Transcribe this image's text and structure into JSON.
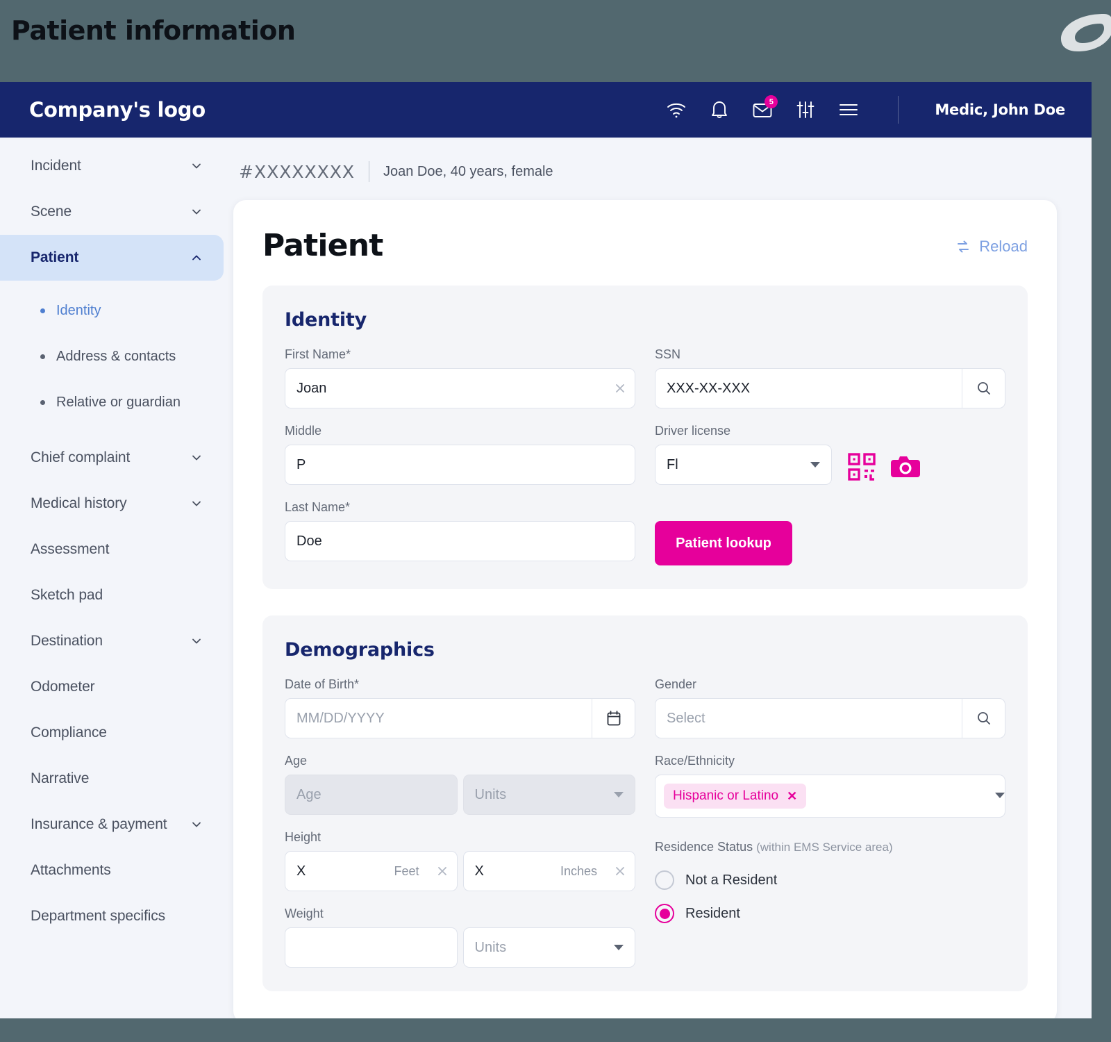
{
  "slide": {
    "title": "Patient information",
    "brand_mark_icon": "leaf-logo-mark"
  },
  "topbar": {
    "logo_text": "Company's logo",
    "user_name": "Medic, John Doe",
    "icons": [
      {
        "name": "wifi-icon",
        "label": "wifi"
      },
      {
        "name": "bell-icon",
        "label": "notifications"
      },
      {
        "name": "mail-icon",
        "label": "messages",
        "badge": "5"
      },
      {
        "name": "sliders-icon",
        "label": "settings"
      },
      {
        "name": "hamburger-icon",
        "label": "menu"
      }
    ]
  },
  "sidebar": {
    "items": [
      {
        "label": "Incident",
        "expandable": true,
        "state": "collapsed"
      },
      {
        "label": "Scene",
        "expandable": true,
        "state": "collapsed"
      },
      {
        "label": "Patient",
        "expandable": true,
        "state": "expanded",
        "active": true
      },
      {
        "label": "Chief complaint",
        "expandable": true,
        "state": "collapsed"
      },
      {
        "label": "Medical history",
        "expandable": true,
        "state": "collapsed"
      },
      {
        "label": "Assessment",
        "expandable": false
      },
      {
        "label": "Sketch pad",
        "expandable": false
      },
      {
        "label": "Destination",
        "expandable": true,
        "state": "collapsed"
      },
      {
        "label": "Odometer",
        "expandable": false
      },
      {
        "label": "Compliance",
        "expandable": false
      },
      {
        "label": "Narrative",
        "expandable": false
      },
      {
        "label": "Insurance & payment",
        "expandable": true,
        "state": "collapsed"
      },
      {
        "label": "Attachments",
        "expandable": false
      },
      {
        "label": "Department specifics",
        "expandable": false
      }
    ],
    "subitems": [
      {
        "label": "Identity",
        "selected": true
      },
      {
        "label": "Address & contacts",
        "selected": false
      },
      {
        "label": "Relative or guardian",
        "selected": false
      }
    ]
  },
  "breadcrumb": {
    "incident_id": "#XXXXXXXX",
    "patient_summary": "Joan Doe, 40 years, female"
  },
  "page": {
    "title": "Patient",
    "reload_label": "Reload",
    "reload_icon": "refresh-icon"
  },
  "identity": {
    "title": "Identity",
    "first_name": {
      "label": "First Name*",
      "value": "Joan",
      "clear_icon": "close-icon"
    },
    "middle": {
      "label": "Middle",
      "value": "P"
    },
    "last_name": {
      "label": "Last Name*",
      "value": "Doe"
    },
    "ssn": {
      "label": "SSN",
      "value": "XXX-XX-XXX",
      "search_icon": "search-icon"
    },
    "driver_license": {
      "label": "Driver license",
      "value": "Fl",
      "caret_icon": "chevron-down-icon"
    },
    "qr_icon": "qr-code-icon",
    "camera_icon": "camera-icon",
    "lookup_button": "Patient lookup"
  },
  "demographics": {
    "title": "Demographics",
    "dob": {
      "label": "Date of Birth*",
      "placeholder": "MM/DD/YYYY",
      "calendar_icon": "calendar-icon"
    },
    "age": {
      "label": "Age",
      "placeholder": "Age",
      "units_placeholder": "Units",
      "disabled": true
    },
    "height": {
      "label": "Height",
      "feet_value": "X",
      "feet_unit": "Feet",
      "inches_value": "X",
      "inches_unit": "Inches"
    },
    "weight": {
      "label": "Weight",
      "value": "",
      "units_placeholder": "Units"
    },
    "gender": {
      "label": "Gender",
      "placeholder": "Select",
      "search_icon": "search-icon"
    },
    "race_ethnicity": {
      "label": "Race/Ethnicity",
      "chips": [
        {
          "label": "Hispanic or Latino",
          "remove_icon": "close-icon"
        }
      ],
      "caret_icon": "chevron-down-icon"
    },
    "residence_status": {
      "label": "Residence Status",
      "label_sub": "(within EMS Service area)",
      "options": [
        {
          "label": "Not a Resident",
          "selected": false
        },
        {
          "label": "Resident",
          "selected": true
        }
      ]
    }
  },
  "colors": {
    "navy": "#17266d",
    "magenta": "#e6009b",
    "link_blue": "#7da0e2",
    "page_bg": "#f3f5fa",
    "panel_bg": "#f4f5f8",
    "slide_bg": "#52686f",
    "active_nav_bg": "#d4e3f8"
  }
}
